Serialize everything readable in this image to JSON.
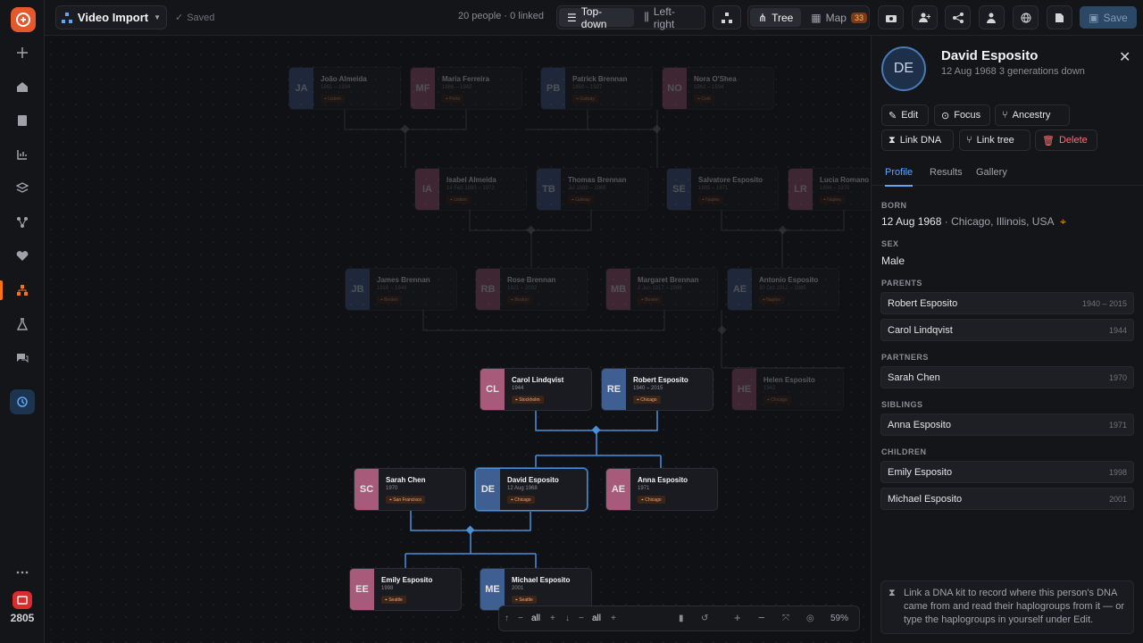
{
  "app": {
    "project_name": "Video Import",
    "saved_label": "Saved",
    "counts_label": "20 people · 0 linked",
    "orientation": {
      "top_down": "Top-down",
      "left_right": "Left-right"
    },
    "view": {
      "tree": "Tree",
      "map": "Map",
      "map_count": "33"
    },
    "save_label": "Save",
    "rail_count": "2805"
  },
  "tree": {
    "people": [
      {
        "initials": "JA",
        "name": "João Almeida",
        "years": "1861 – 1934",
        "place": "Lisbon",
        "sex": "m",
        "dim": true
      },
      {
        "initials": "MF",
        "name": "Maria Ferreira",
        "years": "1866 – 1942",
        "place": "Porto",
        "sex": "f",
        "dim": true
      },
      {
        "initials": "PB",
        "name": "Patrick Brennan",
        "years": "1850 – 1927",
        "place": "Galway",
        "sex": "m",
        "dim": true
      },
      {
        "initials": "NO",
        "name": "Nora O'Shea",
        "years": "1862 – 1934",
        "place": "Cork",
        "sex": "f",
        "dim": true
      },
      {
        "initials": "IA",
        "name": "Isabel Almeida",
        "years": "14 Feb 1893 – 1972",
        "place": "Lisbon",
        "sex": "f",
        "dim": true
      },
      {
        "initials": "TB",
        "name": "Thomas Brennan",
        "years": "Jul 1888 – 1965",
        "place": "Galway",
        "sex": "m",
        "dim": true
      },
      {
        "initials": "SE",
        "name": "Salvatore Esposito",
        "years": "1885 – 1971",
        "place": "Naples",
        "sex": "m",
        "dim": true
      },
      {
        "initials": "LR",
        "name": "Lucia Romano",
        "years": "1894 – 1970",
        "place": "Naples",
        "sex": "f",
        "dim": true
      },
      {
        "initials": "JB",
        "name": "James Brennan",
        "years": "1918 – 1944",
        "place": "Boston",
        "sex": "m",
        "dim": true
      },
      {
        "initials": "RB",
        "name": "Rose Brennan",
        "years": "1921 – 2002",
        "place": "Boston",
        "sex": "f",
        "dim": true
      },
      {
        "initials": "MB",
        "name": "Margaret Brennan",
        "years": "2 Jun 1917 – 1998",
        "place": "Boston",
        "sex": "f",
        "dim": true
      },
      {
        "initials": "AE",
        "name": "Antonio Esposito",
        "years": "30 Oct 1912 – 1985",
        "place": "Naples",
        "sex": "m",
        "dim": true
      },
      {
        "initials": "CL",
        "name": "Carol Lindqvist",
        "years": "1944",
        "place": "Stockholm",
        "sex": "f",
        "dim": false
      },
      {
        "initials": "RE",
        "name": "Robert Esposito",
        "years": "1940 – 2015",
        "place": "Chicago",
        "sex": "m",
        "dim": false
      },
      {
        "initials": "HE",
        "name": "Helen Esposito",
        "years": "1942",
        "place": "Chicago",
        "sex": "f",
        "dim": true
      },
      {
        "initials": "SC",
        "name": "Sarah Chen",
        "years": "1970",
        "place": "San Francisco",
        "sex": "f",
        "dim": false
      },
      {
        "initials": "DE",
        "name": "David Esposito",
        "years": "12 Aug 1968",
        "place": "Chicago",
        "sex": "m",
        "dim": false,
        "selected": true
      },
      {
        "initials": "AE",
        "name": "Anna Esposito",
        "years": "1971",
        "place": "Chicago",
        "sex": "f",
        "dim": false
      },
      {
        "initials": "EE",
        "name": "Emily Esposito",
        "years": "1998",
        "place": "Seattle",
        "sex": "f",
        "dim": false
      },
      {
        "initials": "ME",
        "name": "Michael Esposito",
        "years": "2001",
        "place": "Seattle",
        "sex": "m",
        "dim": false
      }
    ],
    "zoom": {
      "up_value": "all",
      "down_value": "all",
      "zoom_level": "59%"
    }
  },
  "panel": {
    "initials": "DE",
    "name": "David Esposito",
    "subtitle": "12 Aug 1968 3 generations down",
    "actions": {
      "edit": "Edit",
      "focus": "Focus",
      "ancestry": "Ancestry",
      "link_dna": "Link DNA",
      "link_tree": "Link tree",
      "delete": "Delete"
    },
    "tabs": {
      "profile": "Profile",
      "results": "Results",
      "gallery": "Gallery"
    },
    "born_label": "BORN",
    "born_date": "12 Aug 1968",
    "born_place": "· Chicago, Illinois, USA",
    "sex_label": "SEX",
    "sex_value": "Male",
    "parents_label": "PARENTS",
    "parents": [
      {
        "name": "Robert Esposito",
        "years": "1940 – 2015"
      },
      {
        "name": "Carol Lindqvist",
        "years": "1944"
      }
    ],
    "partners_label": "PARTNERS",
    "partners": [
      {
        "name": "Sarah Chen",
        "years": "1970"
      }
    ],
    "siblings_label": "SIBLINGS",
    "siblings": [
      {
        "name": "Anna Esposito",
        "years": "1971"
      }
    ],
    "children_label": "CHILDREN",
    "children": [
      {
        "name": "Emily Esposito",
        "years": "1998"
      },
      {
        "name": "Michael Esposito",
        "years": "2001"
      }
    ],
    "tip": "Link a DNA kit to record where this person's DNA came from and read their haplogroups from it — or type the haplogroups in yourself under Edit."
  },
  "colors": {
    "accent": "#f97316",
    "male": "#3f5f93",
    "female": "#a85a7a",
    "link": "#4a90d9",
    "delete": "#f87171"
  }
}
